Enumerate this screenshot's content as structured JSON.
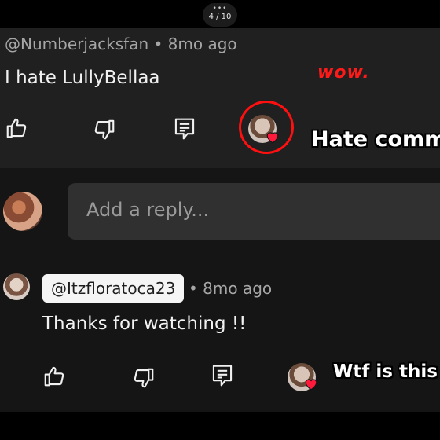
{
  "viewer": {
    "page_dots": "•••",
    "page_counter": "4 / 10"
  },
  "comment": {
    "author": "@Numberjacksfan",
    "time": "8mo ago",
    "separator": "•",
    "text": "I hate LullyBellaa",
    "actions": [
      "like-icon",
      "dislike-icon",
      "reply-icon",
      "creator-heart-icon"
    ]
  },
  "annotations": {
    "wow": "wow.",
    "hate": "Hate comme",
    "wtf": "Wtf is this r"
  },
  "reply_input": {
    "placeholder": "Add a reply..."
  },
  "reply": {
    "mention": "@Itzfloratoca23",
    "separator": "•",
    "time": "8mo ago",
    "text": "Thanks for watching  !!",
    "actions": [
      "like-icon",
      "dislike-icon",
      "reply-icon",
      "creator-heart-icon"
    ]
  },
  "colors": {
    "background": "#000000",
    "panel": "#151515",
    "comment_panel": "#202020",
    "input": "#303030",
    "secondary_text": "#a6a6a6",
    "annotation_red": "#ff1010",
    "heart": "#ff1a3c"
  }
}
